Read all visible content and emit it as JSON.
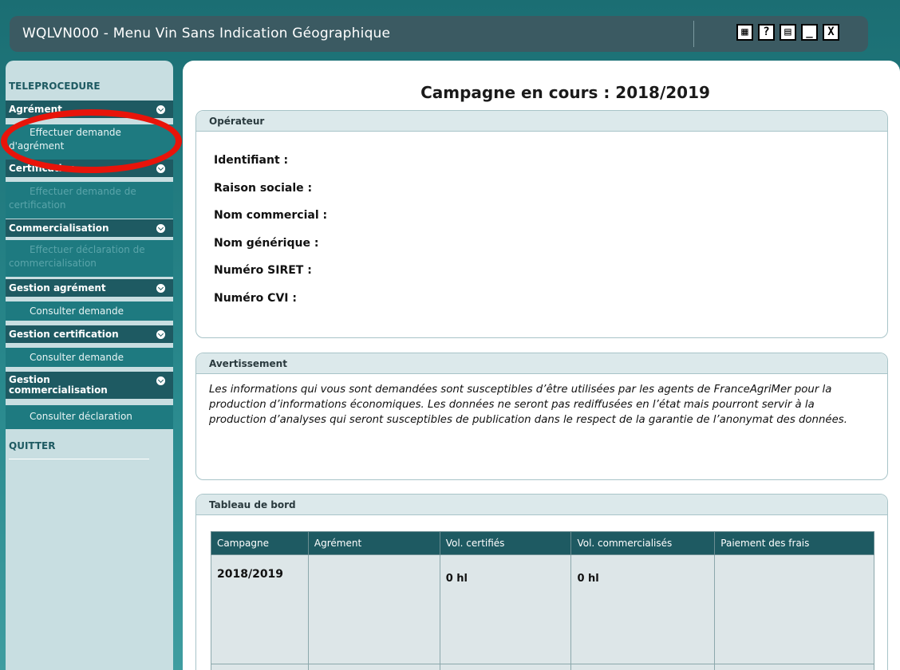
{
  "window": {
    "title": "WQLVN000 - Menu Vin Sans Indication Géographique",
    "buttons": [
      "▦",
      "?",
      "▤",
      "_",
      "X"
    ]
  },
  "sidebar": {
    "title": "TELEPROCEDURE",
    "sections": [
      {
        "label": "Agrément",
        "items": [
          {
            "label": "Effectuer demande d'agrément",
            "disabled": false
          }
        ]
      },
      {
        "label": "Certification",
        "items": [
          {
            "label": "Effectuer demande de certification",
            "disabled": true
          }
        ]
      },
      {
        "label": "Commercialisation",
        "items": [
          {
            "label": "Effectuer déclaration de commercialisation",
            "disabled": true
          }
        ]
      },
      {
        "label": "Gestion agrément",
        "items": [
          {
            "label": "Consulter demande",
            "disabled": false
          }
        ]
      },
      {
        "label": "Gestion certification",
        "items": [
          {
            "label": "Consulter demande",
            "disabled": false
          }
        ]
      },
      {
        "label": "Gestion commercialisation",
        "items": [
          {
            "label": "Consulter déclaration",
            "disabled": false
          }
        ]
      }
    ],
    "quit": "QUITTER"
  },
  "main": {
    "title": "Campagne en cours : 2018/2019",
    "operator": {
      "heading": "Opérateur",
      "fields": [
        "Identifiant :",
        "Raison sociale :",
        "Nom commercial :",
        "Nom générique :",
        "Numéro SIRET :",
        "Numéro CVI :"
      ]
    },
    "warning": {
      "heading": "Avertissement",
      "text": "Les informations qui vous sont demandées sont susceptibles d’être utilisées par les agents de FranceAgriMer pour la production d’informations économiques. Les données ne seront pas rediffusées en l’état mais pourront servir à la production d’analyses qui seront susceptibles de publication dans le respect de la garantie de l’anonymat des données."
    },
    "dashboard": {
      "heading": "Tableau de bord",
      "columns": [
        "Campagne",
        "Agrément",
        "Vol. certifiés",
        "Vol. commercialisés",
        "Paiement des frais"
      ],
      "rows": [
        [
          "2018/2019",
          "",
          "0 hl",
          "0 hl",
          ""
        ]
      ]
    }
  },
  "colors": {
    "teal_dark": "#1e5a62",
    "teal_item": "#1e7a80",
    "annotation": "#e8140a"
  }
}
